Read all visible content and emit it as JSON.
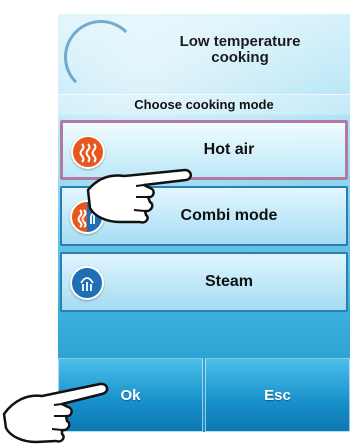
{
  "header": {
    "title": "Low temperature\ncooking",
    "subtitle": "Choose cooking mode"
  },
  "modes": [
    {
      "label": "Hot air",
      "icon": "hot-air-icon",
      "selected": true
    },
    {
      "label": "Combi mode",
      "icon": "combi-mode-icon",
      "selected": false
    },
    {
      "label": "Steam",
      "icon": "steam-icon",
      "selected": false
    }
  ],
  "buttons": {
    "ok_label": "Ok",
    "esc_label": "Esc"
  },
  "colors": {
    "hot_icon": "#e8561e",
    "steam_icon": "#1e6fb5",
    "selected_border": "#b07aa5",
    "button_blue": "#178fca"
  }
}
